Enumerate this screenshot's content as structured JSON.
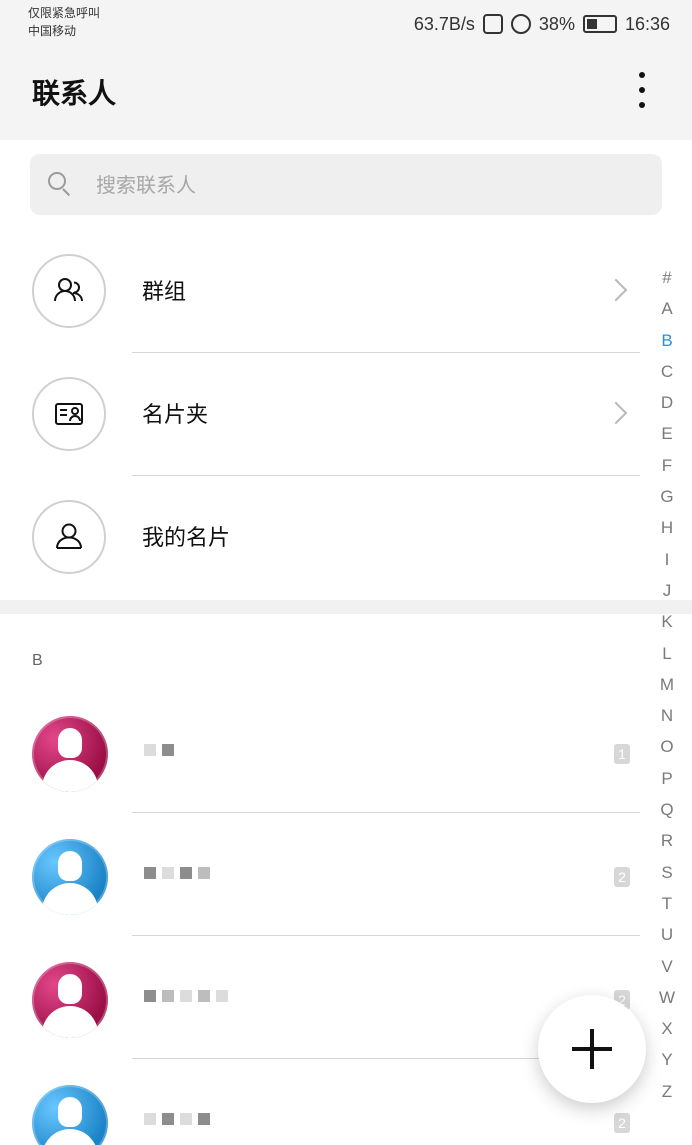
{
  "status_bar": {
    "left_line1": "仅限紧急呼叫",
    "left_line2": "中国移动",
    "network_speed": "63.7B/s",
    "battery": "38%",
    "time": "16:36"
  },
  "header": {
    "title": "联系人"
  },
  "search": {
    "placeholder": "搜索联系人"
  },
  "top_items": [
    {
      "label": "群组",
      "icon": "group-icon"
    },
    {
      "label": "名片夹",
      "icon": "business-card-icon"
    },
    {
      "label": "我的名片",
      "icon": "person-icon"
    }
  ],
  "contacts": {
    "section_letter": "B",
    "rows": [
      {
        "count": "1",
        "avatar_color": "magenta"
      },
      {
        "count": "2",
        "avatar_color": "blue"
      },
      {
        "count": "2",
        "avatar_color": "magenta"
      },
      {
        "count": "2",
        "avatar_color": "blue"
      }
    ]
  },
  "alphabet_index": [
    "#",
    "A",
    "B",
    "C",
    "D",
    "E",
    "F",
    "G",
    "H",
    "I",
    "J",
    "K",
    "L",
    "M",
    "N",
    "O",
    "P",
    "Q",
    "R",
    "S",
    "T",
    "U",
    "V",
    "W",
    "X",
    "Y",
    "Z"
  ],
  "alphabet_active": "B",
  "colors": {
    "accent": "#2b8fd6",
    "magenta_avatar": "#b0124f",
    "blue_avatar": "#1b84c7"
  }
}
